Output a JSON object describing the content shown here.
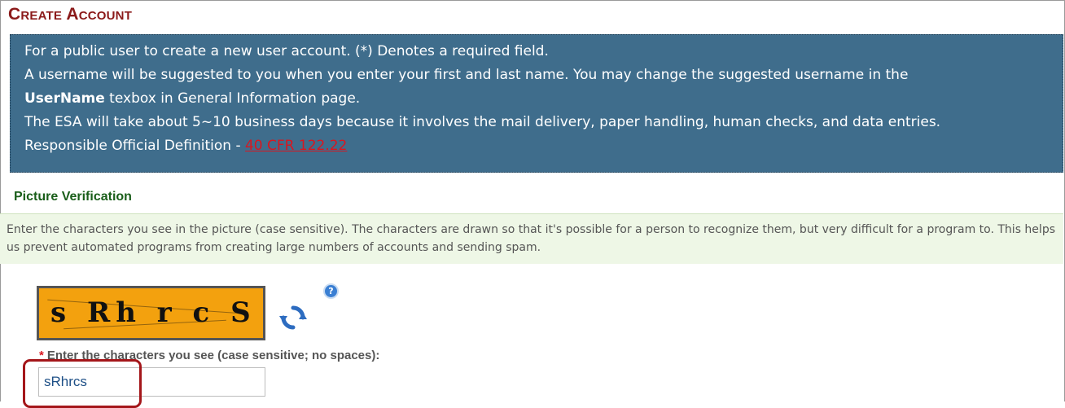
{
  "page": {
    "title": "Create Account"
  },
  "info": {
    "line1": "For a public user to create a new user account. (*) Denotes a required field.",
    "line2": "A username will be suggested to you when you enter your first and last name. You may change the suggested username in the",
    "line3_bold": "UserName",
    "line3_rest": " texbox in General Information page.",
    "line4": "The ESA will take about 5~10 business days because it involves the mail delivery, paper handling, human checks, and data entries.",
    "line5_prefix": "Responsible Official Definition - ",
    "line5_link": "40 CFR 122.22"
  },
  "verification": {
    "title": "Picture Verification",
    "description": "Enter the characters you see in the picture (case sensitive). The characters are drawn so that it's possible for a person to recognize them, but very difficult for a program to. This helps us prevent automated programs from creating large numbers of accounts and sending spam.",
    "captcha_text": "s Rh r c S",
    "refresh_icon": "refresh-icon",
    "help_icon": "help-icon",
    "help_glyph": "?",
    "required_mark": "*",
    "field_label": "Enter the characters you see (case sensitive; no spaces):",
    "field_value": "sRhrcs"
  },
  "colors": {
    "title": "#8b1a1a",
    "info_bg": "#3f6d8c",
    "section_title": "#1a5e1a",
    "section_bg": "#eef7e6",
    "captcha_bg": "#f3a10e",
    "highlight": "#a4161a",
    "link": "#d9161f"
  }
}
